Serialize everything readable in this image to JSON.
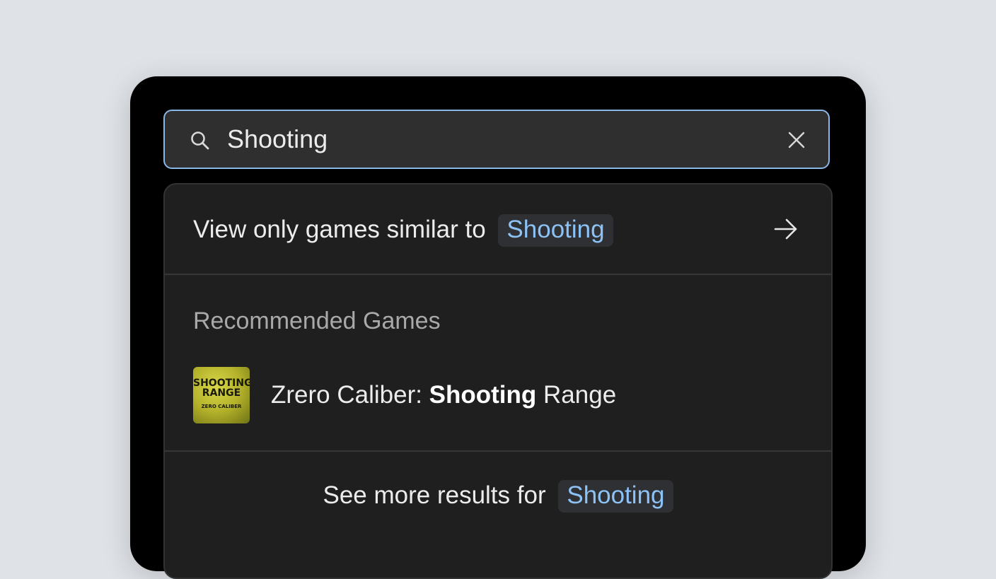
{
  "search": {
    "value": "Shooting",
    "search_icon": "search-icon",
    "clear_icon": "close-icon"
  },
  "dropdown": {
    "similar": {
      "prefix": "View only games similar to",
      "term": "Shooting",
      "icon": "arrow-right-icon"
    },
    "section_title": "Recommended Games",
    "games": [
      {
        "title_prefix": "Zrero Caliber: ",
        "title_match": "Shooting",
        "title_suffix": " Range",
        "thumb_line1": "SHOOTING",
        "thumb_line2": "RANGE",
        "thumb_sub": "ZERO CALIBER"
      }
    ],
    "more": {
      "prefix": "See more results for",
      "term": "Shooting"
    }
  },
  "colors": {
    "accent": "#8cc2f5",
    "search_border": "#8bb6ea",
    "panel": "#1f1f1f"
  }
}
